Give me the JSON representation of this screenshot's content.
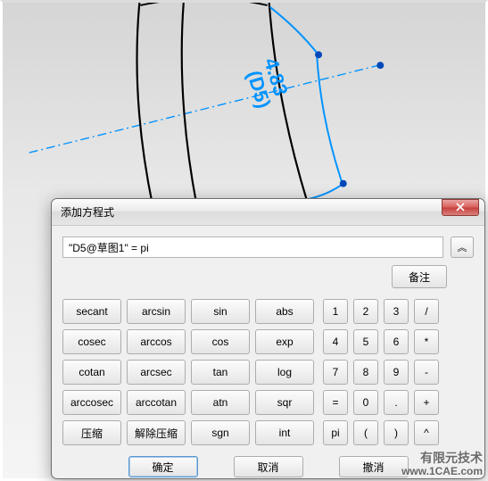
{
  "viewport": {
    "dimension_value": "4.83",
    "dimension_name": "(D5)"
  },
  "dialog": {
    "title": "添加方程式",
    "equation_value": "\"D5@草图1\" = pi",
    "collapse_glyph": "︽",
    "note_button": "备注",
    "func_buttons": [
      [
        "secant",
        "arcsin",
        "sin",
        "abs"
      ],
      [
        "cosec",
        "arccos",
        "cos",
        "exp"
      ],
      [
        "cotan",
        "arcsec",
        "tan",
        "log"
      ],
      [
        "arccosec",
        "arccotan",
        "atn",
        "sqr"
      ],
      [
        "压缩",
        "解除压缩",
        "sgn",
        "int"
      ]
    ],
    "num_buttons": [
      [
        "1",
        "2",
        "3",
        "/"
      ],
      [
        "4",
        "5",
        "6",
        "*"
      ],
      [
        "7",
        "8",
        "9",
        "-"
      ],
      [
        "=",
        "0",
        ".",
        "+"
      ],
      [
        "pi",
        "(",
        ")",
        "^"
      ]
    ],
    "footer": {
      "ok": "确定",
      "cancel": "取消",
      "undo": "撤消"
    }
  },
  "watermark": {
    "line1": "有限元技术",
    "line2": "www.1CAE.com"
  }
}
